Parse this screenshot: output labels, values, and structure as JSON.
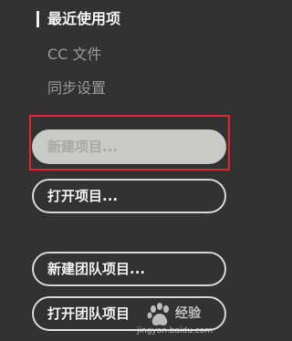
{
  "nav": {
    "recent": "最近使用项",
    "cc_files": "CC 文件",
    "sync_settings": "同步设置"
  },
  "buttons": {
    "new_project": "新建项目...",
    "open_project": "打开项目...",
    "new_team_project": "新建团队项目...",
    "open_team_project": "打开团队项目"
  },
  "watermark": {
    "site_name": "经验",
    "url": "jingyan.baidu.com",
    "logo_icon": "baidu-paw-icon"
  },
  "colors": {
    "background": "#323232",
    "highlight": "#e2262c"
  }
}
